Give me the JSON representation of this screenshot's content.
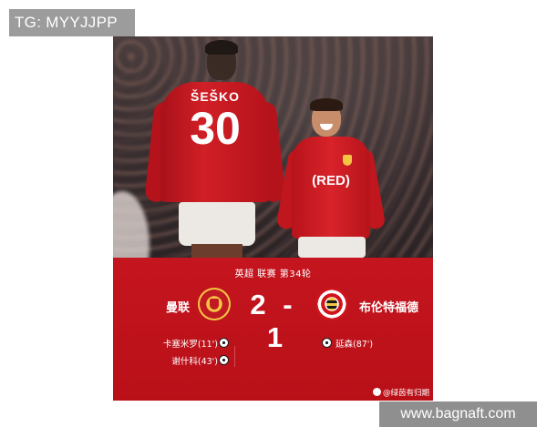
{
  "overlay": {
    "tg_tag": "TG: MYYJJPP",
    "url_tag": "www.bagnaft.com"
  },
  "photo": {
    "player1_name": "ŠEŠKO",
    "player1_number": "30",
    "player2_sponsor": "(RED)"
  },
  "match": {
    "competition": "英超 联赛 第34轮",
    "home_team": "曼联",
    "away_team": "布伦特福德",
    "home_score": "2",
    "away_score": "1",
    "score_separator": "-",
    "home_scorers": [
      "卡塞米罗(11')",
      "谢什科(43')"
    ],
    "away_scorers": [
      "延森(87')"
    ]
  },
  "watermark": {
    "weibo_handle": "@绿茵有归期"
  },
  "colors": {
    "panel_red": "#c5151f",
    "home_crest_gold": "#f4c542"
  }
}
